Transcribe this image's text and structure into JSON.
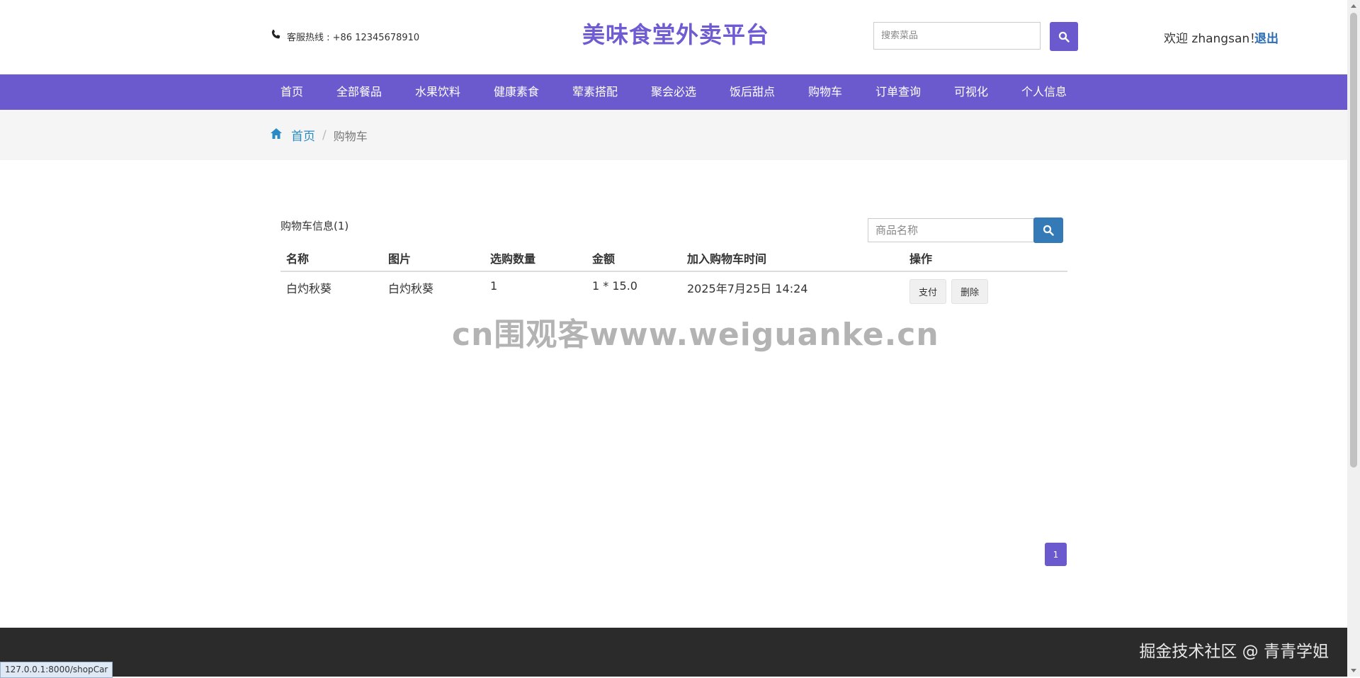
{
  "header": {
    "hotline": "客服热线 : +86 12345678910",
    "site_title": "美味食堂外卖平台",
    "search_placeholder": "搜索菜品",
    "welcome": "欢迎 zhangsan！",
    "logout": "退出"
  },
  "nav": {
    "items": [
      {
        "label": "首页"
      },
      {
        "label": "全部餐品"
      },
      {
        "label": "水果饮料"
      },
      {
        "label": "健康素食"
      },
      {
        "label": "荤素搭配"
      },
      {
        "label": "聚会必选"
      },
      {
        "label": "饭后甜点"
      },
      {
        "label": "购物车"
      },
      {
        "label": "订单查询"
      },
      {
        "label": "可视化"
      },
      {
        "label": "个人信息"
      }
    ]
  },
  "breadcrumb": {
    "home": "首页",
    "separator": "/",
    "current": "购物车"
  },
  "cart": {
    "title": "购物车信息(1)",
    "filter_placeholder": "商品名称",
    "columns": [
      "名称",
      "图片",
      "选购数量",
      "金额",
      "加入购物车时间",
      "操作"
    ],
    "rows": [
      {
        "name": "白灼秋葵",
        "image": "白灼秋葵",
        "quantity": "1",
        "amount": "1 * 15.0",
        "added_time": "2025年7月25日 14:24",
        "pay_label": "支付",
        "delete_label": "删除"
      }
    ]
  },
  "watermark": "cn围观客www.weiguanke.cn",
  "pagination": {
    "current_page": "1"
  },
  "footer": {
    "credit": "掘金技术社区 @ 青青学姐"
  },
  "status_bar": {
    "url": "127.0.0.1:8000/shopCar"
  },
  "colors": {
    "brand_purple": "#6a5acd",
    "title_purple": "#6f5bd2",
    "link_blue": "#2a8ac4",
    "filter_button_blue": "#337ab7",
    "footer_dark": "#2b2b2b"
  },
  "icons": [
    "phone-icon",
    "search-icon",
    "home-icon",
    "search-icon"
  ]
}
